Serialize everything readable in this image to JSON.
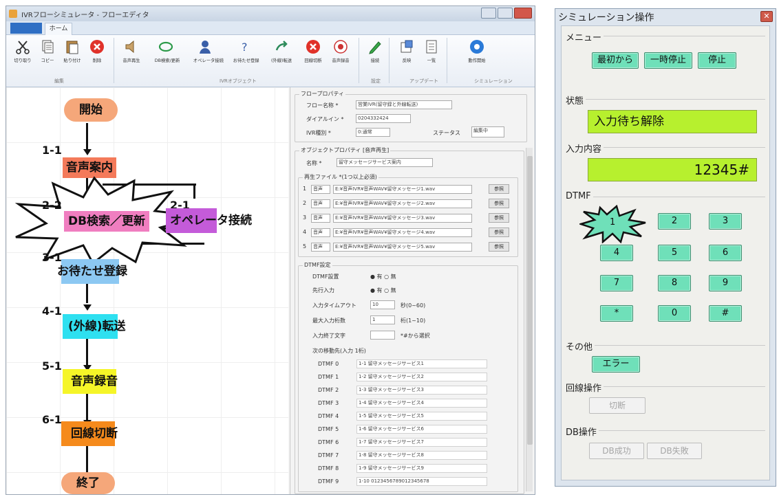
{
  "main_window": {
    "title": "IVRフローシミュレータ - フローエディタ",
    "tabs": {
      "file": "",
      "home": "ホーム"
    },
    "ribbon": {
      "groups": [
        {
          "label": "編集",
          "buttons": [
            "切り取り",
            "コピー",
            "貼り付け",
            "削除"
          ]
        },
        {
          "label": "IVRオブジェクト",
          "buttons": [
            "音声再生",
            "DB検索/更新",
            "オペレータ接続",
            "お待たせ登録",
            "(外線)転送",
            "回線切断",
            "音声録音"
          ]
        },
        {
          "label": "設定",
          "buttons": [
            "接続"
          ]
        },
        {
          "label": "アップデート",
          "buttons": [
            "反映",
            "一覧"
          ]
        },
        {
          "label": "シミュレーション",
          "buttons": [
            "動作開始"
          ]
        }
      ]
    },
    "flow": {
      "start": "開始",
      "end": "終了",
      "nodes": [
        {
          "num": "1-1",
          "label": "音声案内",
          "color": "#f47a5a"
        },
        {
          "num": "2-2",
          "label": "DB検索／更新",
          "color": "#f07ec0"
        },
        {
          "num": "2-1",
          "label": "オペレータ接続",
          "color": "#c45bd9"
        },
        {
          "num": "3-1",
          "label": "お待たせ登録",
          "color": "#8cc8f2"
        },
        {
          "num": "4-1",
          "label": "(外線)転送",
          "color": "#2ee0f0"
        },
        {
          "num": "5-1",
          "label": "音声録音",
          "color": "#f5f528"
        },
        {
          "num": "6-1",
          "label": "回線切断",
          "color": "#f58a1c"
        }
      ],
      "terminal_color": "#f5a77a"
    },
    "flow_props": {
      "title": "フロープロパティ",
      "name_label": "フロー名称 *",
      "name_value": "営業IVR(留守録と外線転送)",
      "dial_label": "ダイアルイン *",
      "dial_value": "0204332424",
      "type_label": "IVR種別 *",
      "type_value": "0:通常",
      "status_label": "ステータス",
      "status_value": "編集中"
    },
    "object_props": {
      "title": "オブジェクトプロパティ [音声再生]",
      "name_label": "名称 *",
      "name_value": "留守メッセージサービス案内",
      "files_label": "再生ファイル *(1つ以上必須)",
      "file_rows": [
        {
          "n": "1",
          "mode": "音声",
          "path": "E:¥音声IVR¥音声WAV¥留守メッセージ1.wav",
          "btn": "参照"
        },
        {
          "n": "2",
          "mode": "音声",
          "path": "E:¥音声IVR¥音声WAV¥留守メッセージ2.wav",
          "btn": "参照"
        },
        {
          "n": "3",
          "mode": "音声",
          "path": "E:¥音声IVR¥音声WAV¥留守メッセージ3.wav",
          "btn": "参照"
        },
        {
          "n": "4",
          "mode": "音声",
          "path": "E:¥音声IVR¥音声WAV¥留守メッセージ4.wav",
          "btn": "参照"
        },
        {
          "n": "5",
          "mode": "音声",
          "path": "E:¥音声IVR¥音声WAV¥留守メッセージ5.wav",
          "btn": "参照"
        }
      ],
      "dtmf_title": "DTMF設定",
      "dtmf_rows": [
        {
          "label": "DTMF設置",
          "value": "● 有 ○ 無"
        },
        {
          "label": "先行入力",
          "value": "● 有 ○ 無"
        },
        {
          "label": "入力タイムアウト",
          "value": "10",
          "suffix": "秒(0~60)"
        },
        {
          "label": "最大入力桁数",
          "value": "1",
          "suffix": "桁(1~10)"
        },
        {
          "label": "入力終了文字",
          "value": "",
          "suffix": "*#から選択"
        }
      ],
      "next_label": "次の移動先(入力 1桁)",
      "next_rows": [
        {
          "k": "DTMF 0",
          "v": "1-1 留守メッセージサービス1"
        },
        {
          "k": "DTMF 1",
          "v": "1-2 留守メッセージサービス2"
        },
        {
          "k": "DTMF 2",
          "v": "1-3 留守メッセージサービス3"
        },
        {
          "k": "DTMF 3",
          "v": "1-4 留守メッセージサービス4"
        },
        {
          "k": "DTMF 4",
          "v": "1-5 留守メッセージサービス5"
        },
        {
          "k": "DTMF 5",
          "v": "1-6 留守メッセージサービス6"
        },
        {
          "k": "DTMF 6",
          "v": "1-7 留守メッセージサービス7"
        },
        {
          "k": "DTMF 7",
          "v": "1-8 留守メッセージサービス8"
        },
        {
          "k": "DTMF 8",
          "v": "1-9 留守メッセージサービス9"
        },
        {
          "k": "DTMF 9",
          "v": "1-10 0123456789012345678"
        }
      ]
    }
  },
  "sim": {
    "title": "シミュレーション操作",
    "close": "✕",
    "menu_head": "メニュー",
    "menu_buttons": [
      "最初から",
      "一時停止",
      "停止"
    ],
    "status_head": "状態",
    "status_value": "入力待ち解除",
    "input_head": "入力内容",
    "input_value": "12345#",
    "dtmf_head": "DTMF",
    "keys": [
      "1",
      "2",
      "3",
      "4",
      "5",
      "6",
      "7",
      "8",
      "9",
      "*",
      "0",
      "#"
    ],
    "other_head": "その他",
    "error_button": "エラー",
    "line_head": "回線操作",
    "disconnect_button": "切断",
    "db_head": "DB操作",
    "db_success": "DB成功",
    "db_fail": "DB失敗"
  }
}
